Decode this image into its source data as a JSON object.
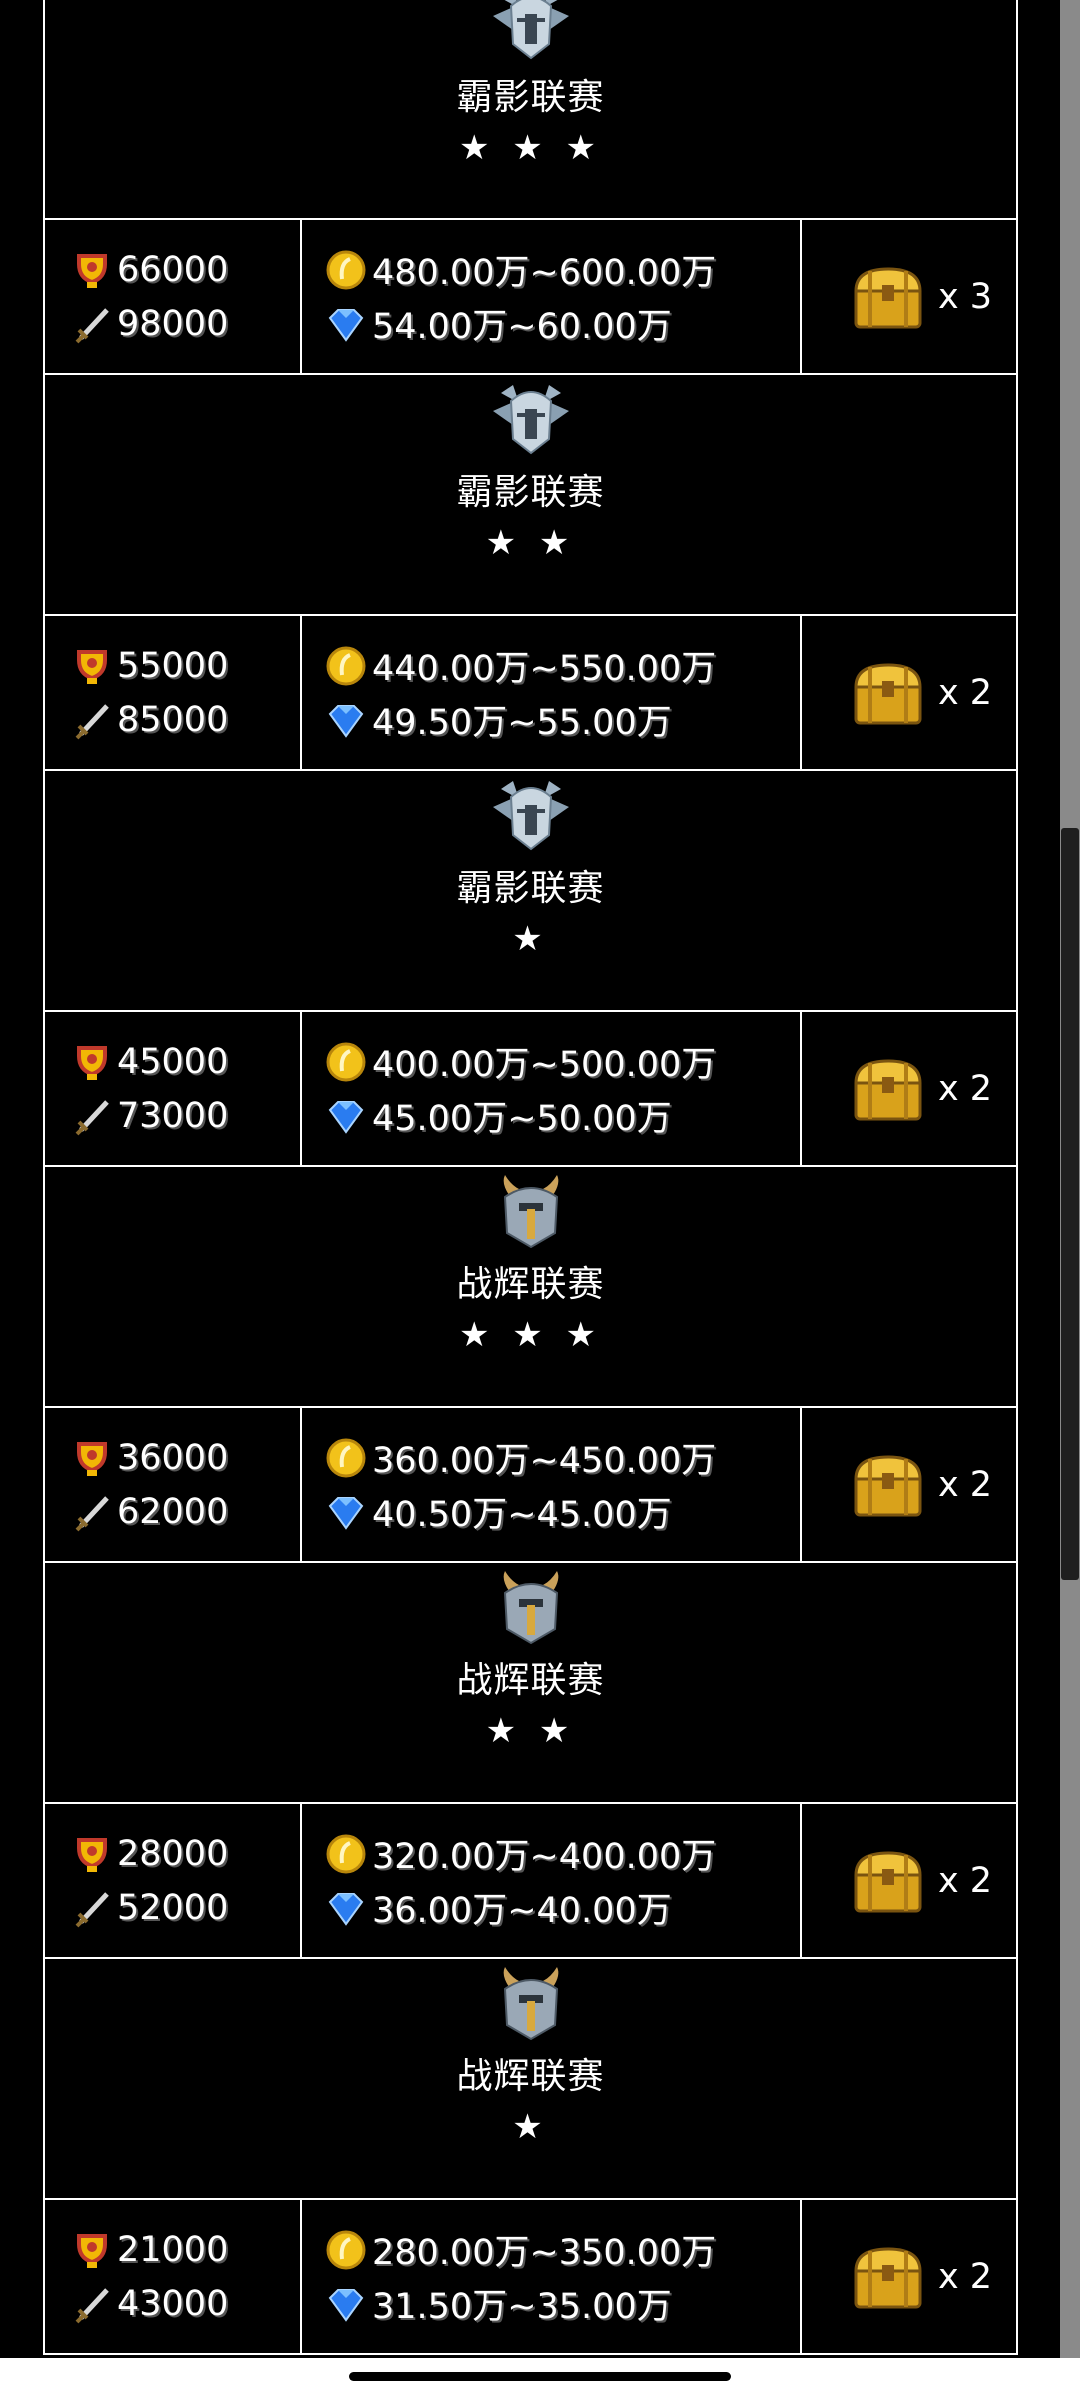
{
  "tiers": [
    {
      "name": "霸影联赛",
      "stars": "★ ★ ★",
      "emblem": "silver-helmet-icon",
      "trophy": "66000",
      "power": "98000",
      "gold": "480.00万~600.00万",
      "gem": "54.00万~60.00万",
      "chest": "x 3"
    },
    {
      "name": "霸影联赛",
      "stars": "★ ★",
      "emblem": "silver-helmet-icon",
      "trophy": "55000",
      "power": "85000",
      "gold": "440.00万~550.00万",
      "gem": "49.50万~55.00万",
      "chest": "x 2"
    },
    {
      "name": "霸影联赛",
      "stars": "★",
      "emblem": "silver-helmet-icon",
      "trophy": "45000",
      "power": "73000",
      "gold": "400.00万~500.00万",
      "gem": "45.00万~50.00万",
      "chest": "x 2"
    },
    {
      "name": "战辉联赛",
      "stars": "★ ★ ★",
      "emblem": "horned-helmet-icon",
      "trophy": "36000",
      "power": "62000",
      "gold": "360.00万~450.00万",
      "gem": "40.50万~45.00万",
      "chest": "x 2"
    },
    {
      "name": "战辉联赛",
      "stars": "★ ★",
      "emblem": "horned-helmet-icon",
      "trophy": "28000",
      "power": "52000",
      "gold": "320.00万~400.00万",
      "gem": "36.00万~40.00万",
      "chest": "x 2"
    },
    {
      "name": "战辉联赛",
      "stars": "★",
      "emblem": "horned-helmet-icon",
      "trophy": "21000",
      "power": "43000",
      "gold": "280.00万~350.00万",
      "gem": "31.50万~35.00万",
      "chest": "x 2"
    }
  ],
  "colors": {
    "background": "#000000",
    "border": "#ffffff",
    "gold": "#f2c21a",
    "gem": "#2a7cf0",
    "trophy": "#e03030"
  }
}
